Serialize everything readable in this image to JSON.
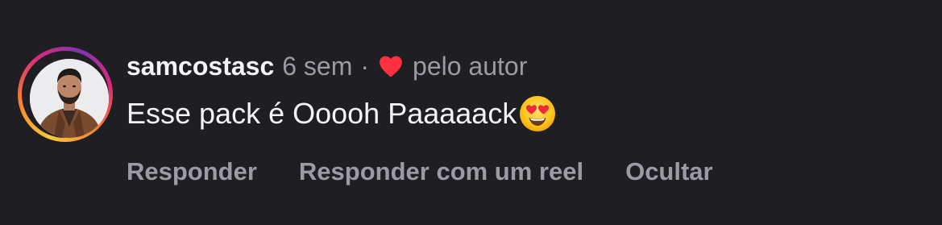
{
  "comment": {
    "username": "samcostasc",
    "time": "6 sem",
    "separator": "·",
    "liked_by_author_label": "pelo autor",
    "heart_icon": "heart-filled-icon",
    "heart_color": "#ff3040",
    "text": "Esse pack é Ooooh Paaaaack",
    "emoji": "smiling-face-with-heart-eyes",
    "avatar_ring_colors": [
      "#f9c838",
      "#f58529",
      "#dd2a7b",
      "#8134af"
    ]
  },
  "actions": {
    "reply": "Responder",
    "reply_with_reel": "Responder com um reel",
    "hide": "Ocultar"
  }
}
